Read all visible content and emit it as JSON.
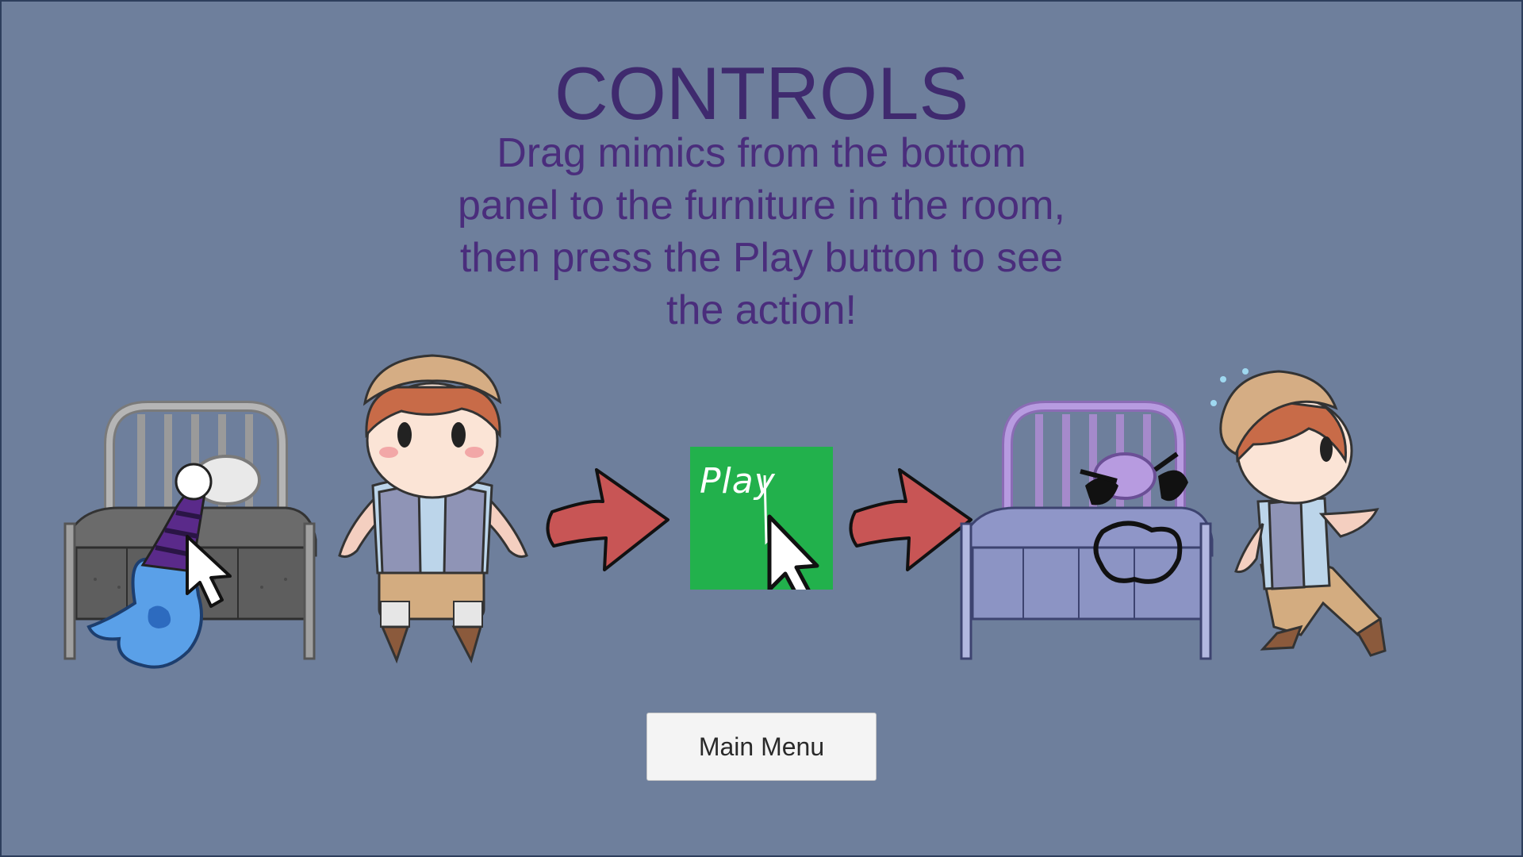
{
  "screen": {
    "title": "CONTROLS",
    "instructions": "Drag mimics from the bottom panel to the furniture in the room, then press the Play button to see the action!"
  },
  "illustration": {
    "play_label": "Play",
    "arrow_color": "#c85555",
    "play_color": "#22b14c",
    "bed_gray": "#8c8c8c",
    "bed_lavender": "#a9aedb",
    "ghost_color": "#5aa0e8"
  },
  "buttons": {
    "main_menu": "Main Menu"
  },
  "colors": {
    "background": "#6e7f9c",
    "title": "#3f2a6e",
    "text": "#4a2d7c"
  }
}
